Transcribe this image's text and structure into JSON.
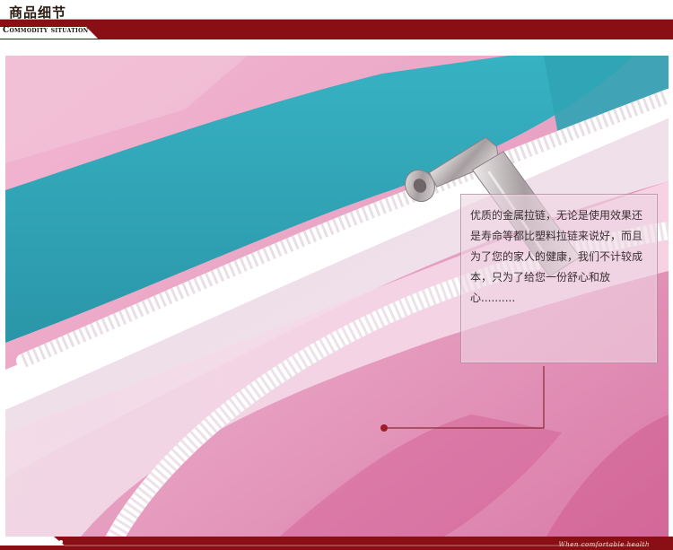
{
  "header": {
    "title": "商品细节",
    "subtitle": "Commodity situation"
  },
  "callout": {
    "text": "优质的金属拉链，无论是使用效果还是寿命等都比塑料拉链来说好，而且为了您的家人的健康，我们不计较成本，只为了给您一份舒心和放心.........."
  },
  "footer": {
    "tagline": "When comfortable health"
  },
  "colors": {
    "accent": "#8a0f14",
    "accent_dark": "#6a0a0d",
    "fabric_teal": "#2fa4b5",
    "fabric_pink": "#e7a3c3",
    "zipper": "#f4f1f3"
  }
}
